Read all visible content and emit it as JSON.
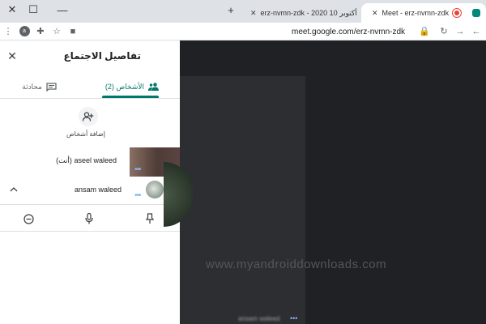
{
  "browser": {
    "tabs": [
      {
        "title": "erz-nvmn-zdk - أكتوبر 10 2020",
        "active": false
      },
      {
        "title": "Meet - erz-nvmn-zdk",
        "active": true
      }
    ],
    "new_tab": "+",
    "url": "meet.google.com/erz-nvmn-zdk",
    "profile_initial": "a"
  },
  "panel": {
    "title": "تفاصيل الاجتماع",
    "tabs": {
      "people": "الأشخاص (2)",
      "chat": "محادثة"
    },
    "add_people_label": "إضافة أشخاص",
    "participants": [
      {
        "name": "aseel waleed",
        "suffix": "(أنت)"
      },
      {
        "name": "ansam waleed"
      }
    ]
  },
  "main": {
    "watermark": "www.myandroiddownloads.com",
    "tile_name": "ansam waleed"
  },
  "colors": {
    "accent": "#00796b",
    "panel_bg": "#ffffff",
    "stage_bg": "#202124"
  }
}
